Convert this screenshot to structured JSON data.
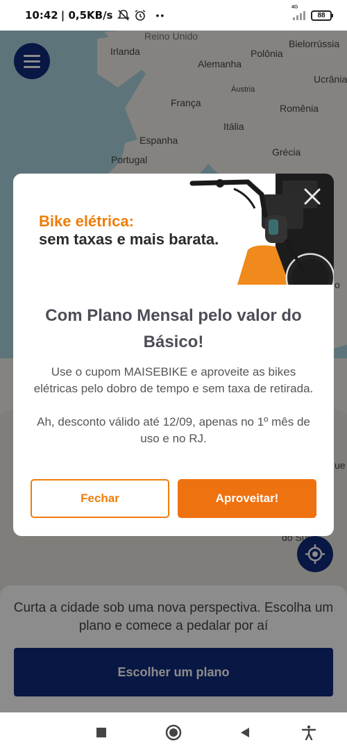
{
  "status_bar": {
    "time": "10:42",
    "network_speed": "| 0,5KB/s",
    "dots": "••",
    "signal_tag": "4G",
    "battery": "88"
  },
  "map": {
    "labels": {
      "reino_unido": "Reino Unido",
      "irlanda": "Irlanda",
      "alemanha": "Alemanha",
      "polonia": "Polônia",
      "bielorrussia": "Bielorrússia",
      "ucrania": "Ucrânia",
      "austria": "Áustria",
      "franca": "França",
      "romenia": "Romênia",
      "italia": "Itália",
      "espanha": "Espanha",
      "grecia": "Grécia",
      "portugal": "Portugal",
      "edge_o": "o",
      "edge_ue": "ue",
      "do_sul": "do Sul"
    }
  },
  "modal": {
    "banner_line1": "Bike elétrica:",
    "banner_line2": "sem taxas e mais barata.",
    "title": "Com Plano Mensal pelo valor do Básico!",
    "body1": "Use o cupom MAISEBIKE e aproveite as bikes elétricas pelo dobro de tempo e sem taxa de retirada.",
    "body2": "Ah, desconto válido até 12/09, apenas no 1º mês de uso e no RJ.",
    "close_label": "Fechar",
    "accept_label": "Aproveitar!"
  },
  "bottom_sheet": {
    "message": "Curta a cidade sob uma nova perspectiva. Escolha um plano e comece a pedalar por aí",
    "cta_label": "Escolher um plano"
  },
  "colors": {
    "brand_blue": "#0f2a7a",
    "brand_orange": "#ef7d0b"
  }
}
